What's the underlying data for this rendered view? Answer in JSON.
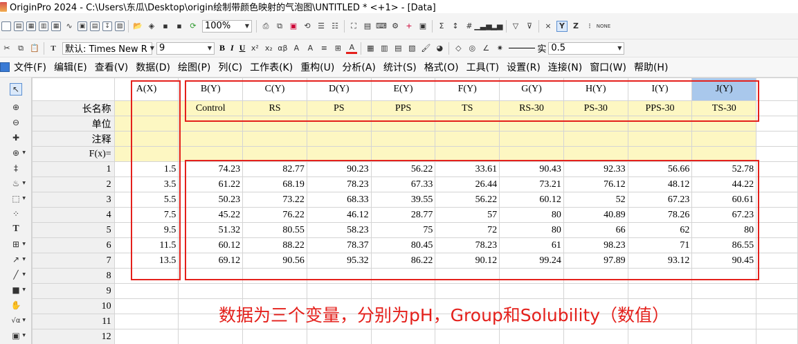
{
  "window": {
    "title": "OriginPro 2024 - C:\\Users\\东瓜\\Desktop\\origin绘制带颜色映射的气泡图\\UNTITLED * <+1> - [Data]"
  },
  "toolbar": {
    "zoom": "100%",
    "font_name": "默认: Times New R",
    "font_size": "9",
    "line_style_label": "实",
    "line_width": "0.5",
    "bold": "B",
    "italic": "I",
    "underline": "U",
    "y_label": "Y",
    "z_label": "Z",
    "x_label": "×"
  },
  "menubar": [
    "文件(F)",
    "编辑(E)",
    "查看(V)",
    "数据(D)",
    "绘图(P)",
    "列(C)",
    "工作表(K)",
    "重构(U)",
    "分析(A)",
    "统计(S)",
    "格式(O)",
    "工具(T)",
    "设置(R)",
    "连接(N)",
    "窗口(W)",
    "帮助(H)"
  ],
  "sheet": {
    "columns": [
      "A(X)",
      "B(Y)",
      "C(Y)",
      "D(Y)",
      "E(Y)",
      "F(Y)",
      "G(Y)",
      "H(Y)",
      "I(Y)",
      "J(Y)"
    ],
    "selected_column": "J(Y)",
    "meta_labels": [
      "长名称",
      "单位",
      "注释",
      "F(x)="
    ],
    "long_names": [
      "",
      "Control",
      "RS",
      "PS",
      "PPS",
      "TS",
      "RS-30",
      "PS-30",
      "PPS-30",
      "TS-30"
    ],
    "row_numbers": [
      "1",
      "2",
      "3",
      "4",
      "5",
      "6",
      "7",
      "8",
      "9",
      "10",
      "11",
      "12"
    ],
    "rows": [
      [
        "1.5",
        "74.23",
        "82.77",
        "90.23",
        "56.22",
        "33.61",
        "90.43",
        "92.33",
        "56.66",
        "52.78"
      ],
      [
        "3.5",
        "61.22",
        "68.19",
        "78.23",
        "67.33",
        "26.44",
        "73.21",
        "76.12",
        "48.12",
        "44.22"
      ],
      [
        "5.5",
        "50.23",
        "73.22",
        "68.33",
        "39.55",
        "56.22",
        "60.12",
        "52",
        "67.23",
        "60.61"
      ],
      [
        "7.5",
        "45.22",
        "76.22",
        "46.12",
        "28.77",
        "57",
        "80",
        "40.89",
        "78.26",
        "67.23"
      ],
      [
        "9.5",
        "51.32",
        "80.55",
        "58.23",
        "75",
        "72",
        "80",
        "66",
        "62",
        "80"
      ],
      [
        "11.5",
        "60.12",
        "88.22",
        "78.37",
        "80.45",
        "78.23",
        "61",
        "98.23",
        "71",
        "86.55"
      ],
      [
        "13.5",
        "69.12",
        "90.56",
        "95.32",
        "86.22",
        "90.12",
        "99.24",
        "97.89",
        "93.12",
        "90.45"
      ]
    ]
  },
  "annotation": "数据为三个变量，分别为pH，Group和Solubility（数值）",
  "colors": {
    "highlight_red": "#e4201b",
    "meta_row_yellow": "#fdf7c2",
    "selected_column_blue": "#a9c8ec"
  }
}
